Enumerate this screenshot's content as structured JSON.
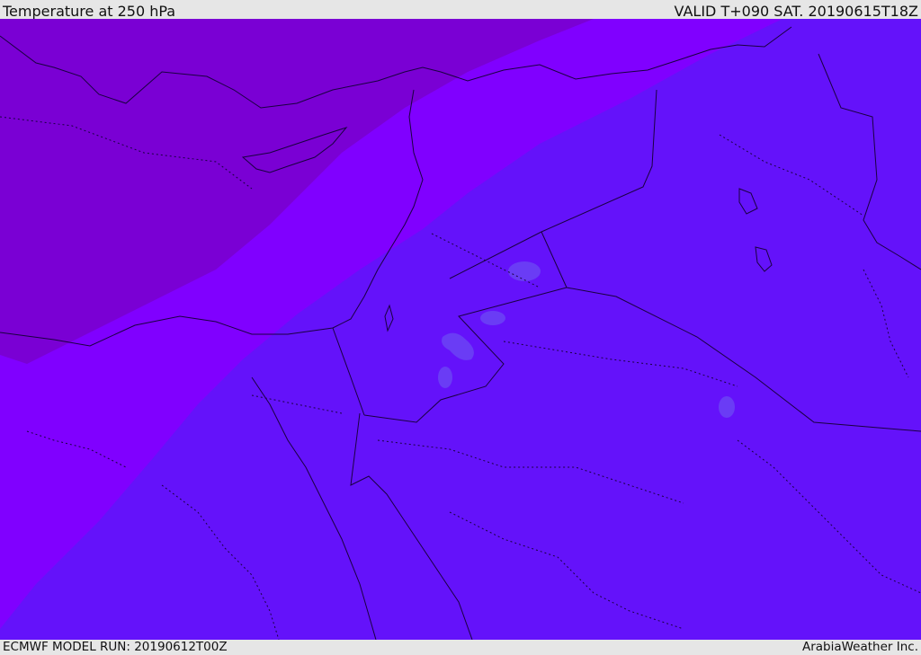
{
  "header": {
    "title": "Temperature at 250 hPa",
    "valid": "VALID T+090 SAT. 20190615T18Z"
  },
  "footer": {
    "model_run": "ECMWF MODEL RUN: 20190612T00Z",
    "credit": "ArabiaWeather Inc."
  },
  "map_style": {
    "band_cold_color": "#7a00d4",
    "band_mid_color": "#8000ff",
    "band_warm_color": "#6412fa",
    "blob_color": "#6a3cf5",
    "coastline_color": "#1a0040",
    "border_color": "#1a0040"
  }
}
